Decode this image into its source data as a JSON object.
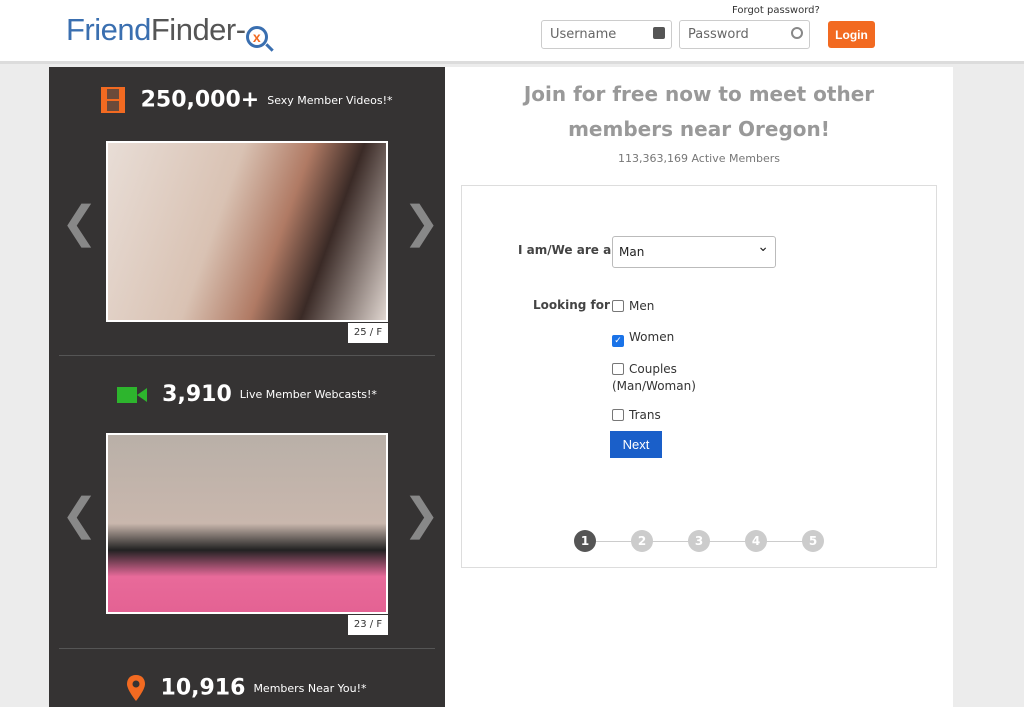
{
  "header": {
    "logo": "FriendFinder-X",
    "logo_a": "Friend",
    "logo_b": "Finder-",
    "logo_x": "x",
    "forgot": "Forgot password?",
    "username_placeholder": "Username",
    "password_placeholder": "Password",
    "login": "Login"
  },
  "sidebar": {
    "videos": {
      "count": "250,000+",
      "label": "Sexy Member Videos!*",
      "age": "25 / F"
    },
    "webcasts": {
      "count": "3,910",
      "label": "Live Member Webcasts!*",
      "age": "23 / F"
    },
    "near": {
      "count": "10,916",
      "label": "Members Near You!*"
    }
  },
  "main": {
    "title": "Join for free now to meet other members near Oregon!",
    "active": "113,363,169 Active Members",
    "iam_label": "I am/We are a",
    "iam_value": "Man",
    "looking_label": "Looking for",
    "options": [
      {
        "label": "Men",
        "checked": false
      },
      {
        "label": "Women",
        "checked": true
      },
      {
        "label": "Couples (Man/Woman)",
        "checked": false
      },
      {
        "label": "Trans",
        "checked": false
      }
    ],
    "next": "Next",
    "steps": [
      "1",
      "2",
      "3",
      "4",
      "5"
    ],
    "current_step": 1
  },
  "colors": {
    "accent": "#f26a21",
    "brand": "#3a6fb0",
    "button": "#1a5fc9"
  }
}
